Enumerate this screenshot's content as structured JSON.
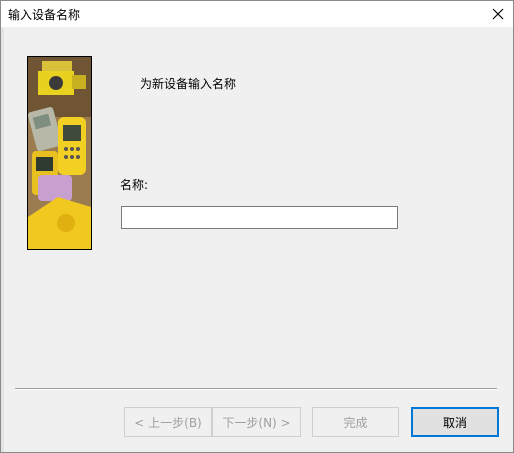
{
  "dialog": {
    "title": "输入设备名称"
  },
  "content": {
    "prompt": "为新设备输入名称",
    "name_label": "名称:",
    "name_value": "",
    "name_placeholder": ""
  },
  "buttons": {
    "back": "< 上一步(B)",
    "next": "下一步(N) >",
    "finish": "完成",
    "cancel": "取消"
  },
  "icons": {
    "close": "close-icon",
    "picture": "survey-devices-image"
  }
}
